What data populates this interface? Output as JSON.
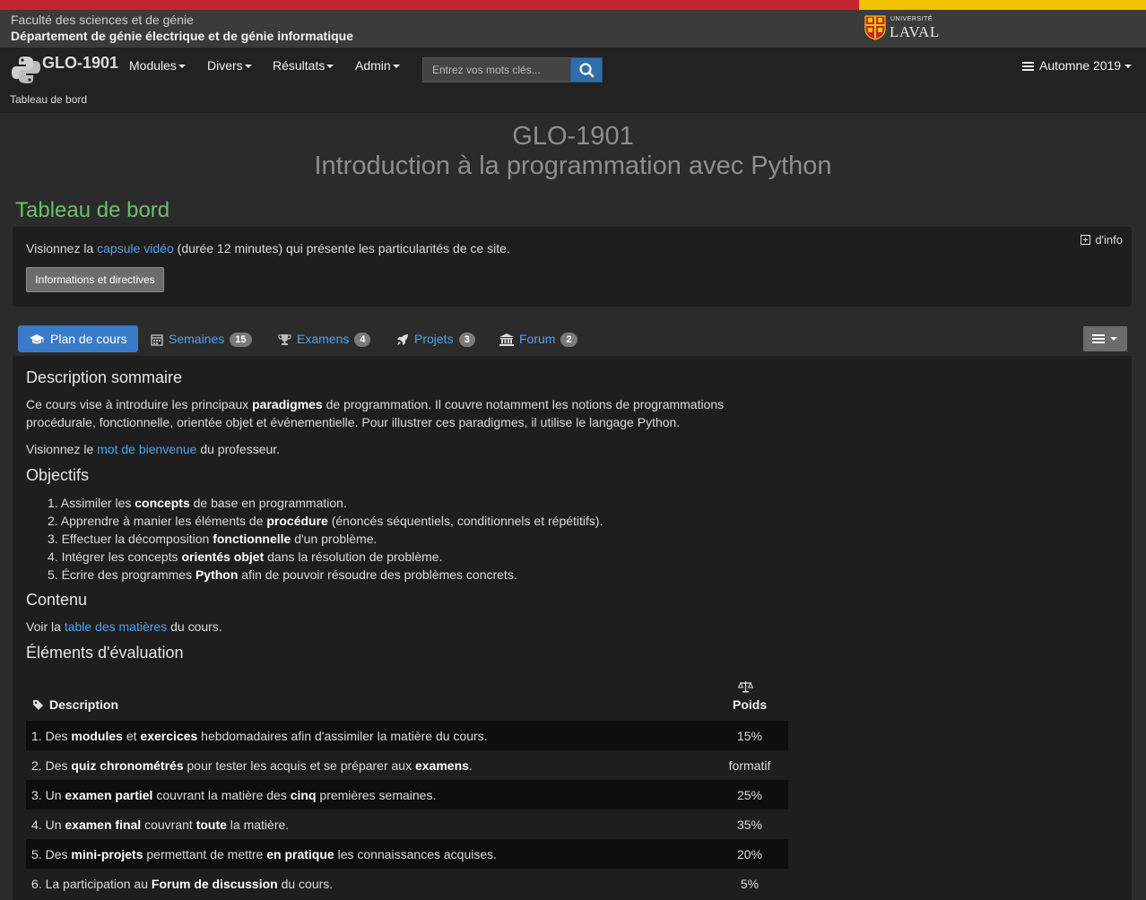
{
  "faculty": {
    "line1": "Faculté des sciences et de génie",
    "line2": "Département de génie électrique et de génie informatique",
    "logo_small": "UNIVERSITÉ",
    "logo_big": "LAVAL"
  },
  "nav": {
    "brand": "GLO-1901",
    "brand_sub": "Tableau de bord",
    "menus": [
      "Modules",
      "Divers",
      "Résultats",
      "Admin"
    ],
    "search_placeholder": "Entrez vos mots clés...",
    "term": "Automne 2019"
  },
  "course": {
    "code": "GLO-1901",
    "name": "Introduction à la programmation avec Python"
  },
  "dashboard_title": "Tableau de bord",
  "info_panel": {
    "text_before": "Visionnez la ",
    "link": "capsule vidéo",
    "text_after": " (durée 12 minutes) qui présente les particularités de ce site.",
    "button": "Informations et directives",
    "more": "d'info"
  },
  "tabs": [
    {
      "label": "Plan de cours",
      "icon": "graduation-cap-icon"
    },
    {
      "label": "Semaines",
      "badge": "15",
      "icon": "calendar-icon"
    },
    {
      "label": "Examens",
      "badge": "4",
      "icon": "trophy-icon"
    },
    {
      "label": "Projets",
      "badge": "3",
      "icon": "rocket-icon"
    },
    {
      "label": "Forum",
      "badge": "2",
      "icon": "institution-icon"
    }
  ],
  "sections": {
    "description": {
      "heading": "Description sommaire",
      "p1_a": "Ce cours vise à introduire les principaux ",
      "p1_b": "paradigmes",
      "p1_c": " de programmation. Il couvre notamment les notions de programmations",
      "p1_line2": "procédurale, fonctionnelle, orientée objet et événementielle. Pour illustrer ces paradigmes, il utilise le langage Python.",
      "p2_a": "Visionnez le ",
      "p2_link": "mot de bienvenue",
      "p2_b": " du professeur."
    },
    "objectifs": {
      "heading": "Objectifs",
      "items": [
        {
          "a": "Assimiler les ",
          "b": "concepts",
          "c": " de base en programmation."
        },
        {
          "a": "Apprendre à manier les éléments de ",
          "b": "procédure",
          "c": " (énoncés séquentiels, conditionnels et répétitifs)."
        },
        {
          "a": "Effectuer la décomposition ",
          "b": "fonctionnelle",
          "c": " d'un problème."
        },
        {
          "a": "Intégrer les concepts ",
          "b": "orientés objet",
          "c": " dans la résolution de problème."
        },
        {
          "a": "Écrire des programmes ",
          "b": "Python",
          "c": " afin de pouvoir résoudre des problèmes concrets."
        }
      ]
    },
    "contenu": {
      "heading": "Contenu",
      "a": "Voir la ",
      "link": "table des matières",
      "b": " du cours."
    },
    "evaluation": {
      "heading": "Éléments d'évaluation",
      "col_desc": "Description",
      "col_weight": "Poids",
      "rows": [
        {
          "num": "1.",
          "parts": [
            "Des ",
            "*modules",
            " et ",
            "*exercices",
            " hebdomadaires afin d'assimiler la matière du cours."
          ],
          "weight": "15%"
        },
        {
          "num": "2.",
          "parts": [
            "Des ",
            "*quiz chronométrés",
            " pour tester les acquis et se préparer aux ",
            "*examens",
            "."
          ],
          "weight": "formatif"
        },
        {
          "num": "3.",
          "parts": [
            "Un ",
            "*examen partiel",
            " couvrant la matière des ",
            "*cinq",
            " premières semaines."
          ],
          "weight": "25%"
        },
        {
          "num": "4.",
          "parts": [
            "Un ",
            "*examen final",
            " couvrant ",
            "*toute",
            " la matière."
          ],
          "weight": "35%"
        },
        {
          "num": "5.",
          "parts": [
            "Des ",
            "*mini-projets",
            " permettant de mettre ",
            "*en pratique",
            " les connaissances acquises."
          ],
          "weight": "20%"
        },
        {
          "num": "6.",
          "parts": [
            "La participation au ",
            "*Forum de discussion",
            " du cours."
          ],
          "weight": "5%"
        }
      ]
    }
  }
}
